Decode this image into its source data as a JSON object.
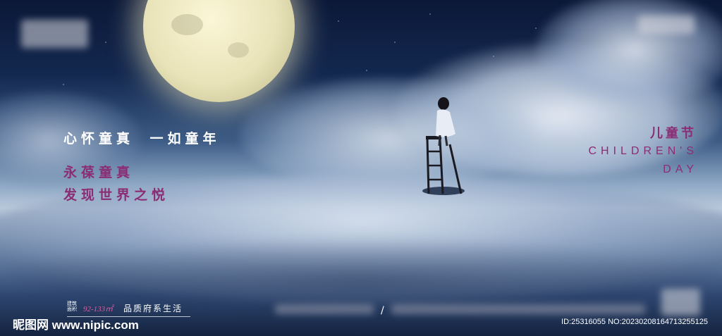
{
  "headline": "心怀童真  一如童年",
  "subline1": "永葆童真",
  "subline2": "发现世界之悦",
  "right_title": "儿童节",
  "right_en_line1": "CHILDREN'S",
  "right_en_line2": "DAY",
  "footer": {
    "area_label": "建筑\n面积",
    "area_value": "92-133㎡",
    "slogan": "品质府系生活"
  },
  "watermark": {
    "left": "昵图网 www.nipic.com",
    "right": "ID:25316055 NO:20230208164713255125"
  },
  "colors": {
    "accent_purple": "#8a2d74",
    "sky_dark": "#0b1838"
  }
}
